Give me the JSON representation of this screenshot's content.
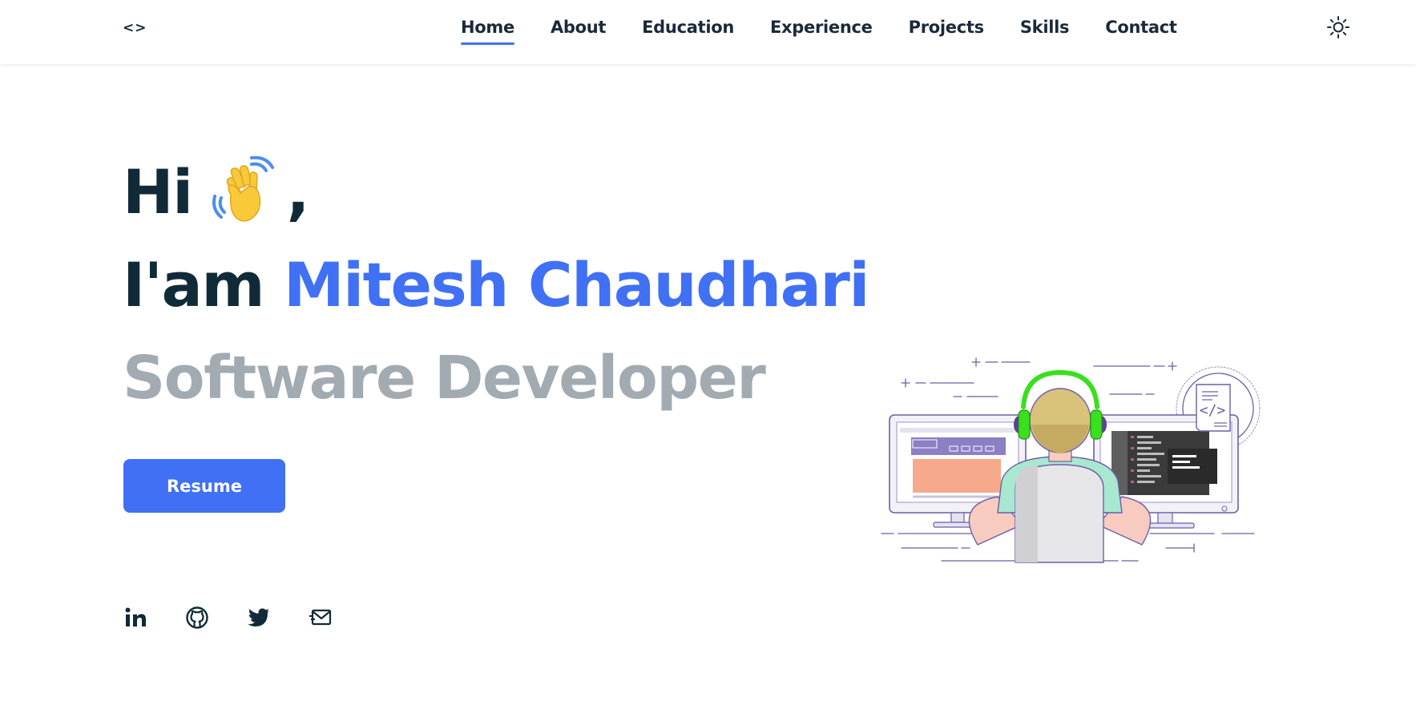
{
  "nav": {
    "logo": "<>",
    "links": [
      "Home",
      "About",
      "Education",
      "Experience",
      "Projects",
      "Skills",
      "Contact"
    ],
    "active": "Home",
    "theme_icon": "sun-icon"
  },
  "hero": {
    "greeting": "Hi",
    "greeting_comma": ",",
    "wave_icon": "waving-hand-icon",
    "intro": "I'am",
    "name": "Mitesh Chaudhari",
    "role": "Software Developer"
  },
  "resume_button": "Resume",
  "socials": [
    "linkedin-icon",
    "github-icon",
    "twitter-icon",
    "mail-icon"
  ],
  "colors": {
    "accent": "#4070f4",
    "text": "#102a38",
    "muted": "#a2abb1"
  }
}
